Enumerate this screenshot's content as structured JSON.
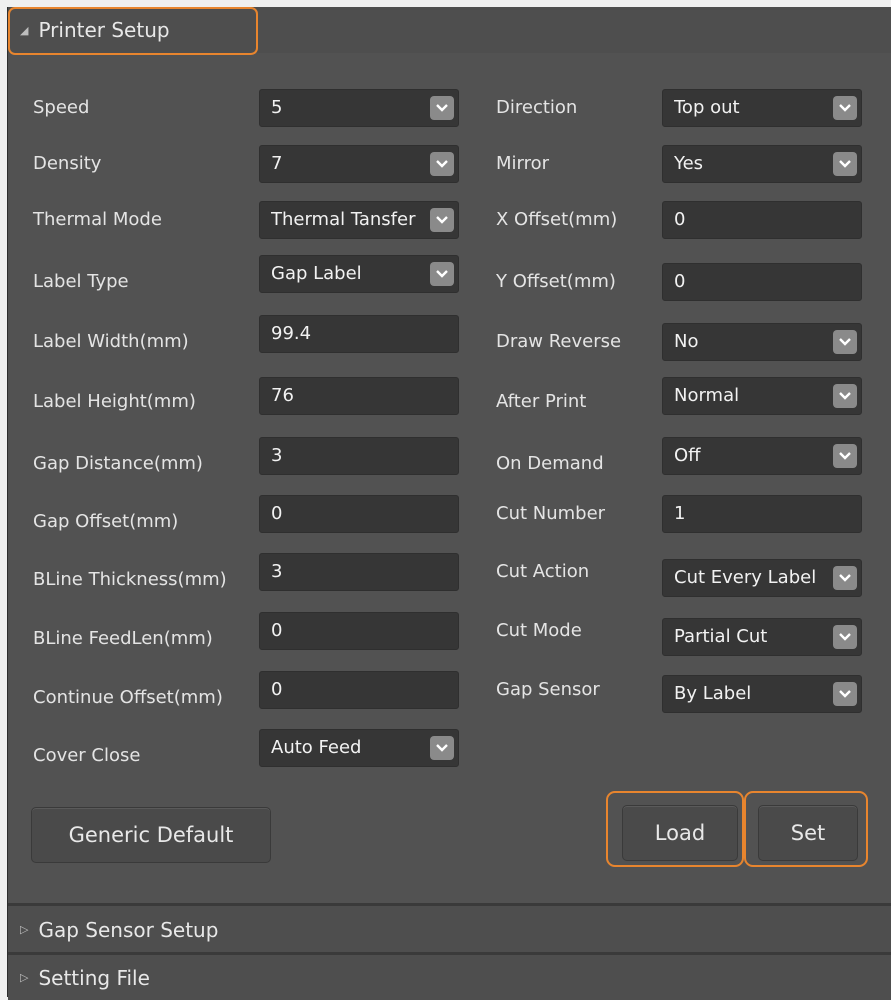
{
  "headers": {
    "printer_setup": "Printer Setup",
    "gap_sensor_setup": "Gap Sensor Setup",
    "setting_file": "Setting File"
  },
  "left": {
    "speed": {
      "label": "Speed",
      "value": "5"
    },
    "density": {
      "label": "Density",
      "value": "7"
    },
    "thermal_mode": {
      "label": "Thermal Mode",
      "value": "Thermal Tansfer"
    },
    "label_type": {
      "label": "Label Type",
      "value": "Gap Label"
    },
    "label_width": {
      "label": "Label Width(mm)",
      "value": "99.4"
    },
    "label_height": {
      "label": "Label Height(mm)",
      "value": "76"
    },
    "gap_distance": {
      "label": "Gap Distance(mm)",
      "value": "3"
    },
    "gap_offset": {
      "label": "Gap Offset(mm)",
      "value": "0"
    },
    "bline_thickness": {
      "label": "BLine Thickness(mm)",
      "value": "3"
    },
    "bline_feedlen": {
      "label": "BLine FeedLen(mm)",
      "value": "0"
    },
    "continue_offset": {
      "label": "Continue Offset(mm)",
      "value": "0"
    },
    "cover_close": {
      "label": "Cover Close",
      "value": "Auto Feed"
    }
  },
  "right": {
    "direction": {
      "label": "Direction",
      "value": "Top out"
    },
    "mirror": {
      "label": "Mirror",
      "value": "Yes"
    },
    "x_offset": {
      "label": "X Offset(mm)",
      "value": "0"
    },
    "y_offset": {
      "label": "Y Offset(mm)",
      "value": "0"
    },
    "draw_reverse": {
      "label": "Draw Reverse",
      "value": "No"
    },
    "after_print": {
      "label": "After Print",
      "value": "Normal"
    },
    "on_demand": {
      "label": "On Demand",
      "value": "Off"
    },
    "cut_number": {
      "label": "Cut Number",
      "value": "1"
    },
    "cut_action": {
      "label": "Cut Action",
      "value": "Cut Every Label"
    },
    "cut_mode": {
      "label": "Cut Mode",
      "value": "Partial Cut"
    },
    "gap_sensor": {
      "label": "Gap Sensor",
      "value": "By Label"
    }
  },
  "buttons": {
    "generic_default": "Generic Default",
    "load": "Load",
    "set": "Set"
  },
  "icons": {
    "expanded": "triangle-expanded-icon",
    "collapsed": "triangle-collapsed-icon",
    "dropdown": "chevron-down-icon"
  },
  "colors": {
    "panel": "#525252",
    "field": "#363636",
    "highlight": "#e8852e"
  }
}
